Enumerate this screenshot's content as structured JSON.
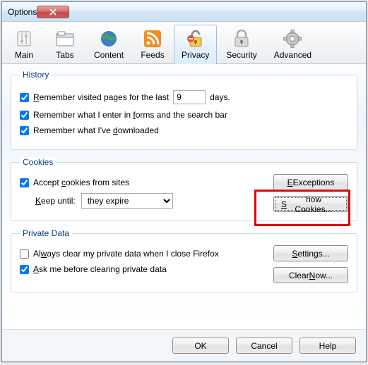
{
  "window": {
    "title": "Options"
  },
  "tabs": [
    {
      "label": "Main"
    },
    {
      "label": "Tabs"
    },
    {
      "label": "Content"
    },
    {
      "label": "Feeds"
    },
    {
      "label": "Privacy"
    },
    {
      "label": "Security"
    },
    {
      "label": "Advanced"
    }
  ],
  "history": {
    "legend": "History",
    "remember_visited": "emember visited pages for the last",
    "days_value": "9",
    "days_suffix": "days.",
    "remember_forms": "Remember what I enter in ",
    "forms_word": "f",
    "forms_rest": "orms and the search bar",
    "remember_downloads": "Remember what I've ",
    "downloads_d": "d",
    "downloads_rest": "ownloaded"
  },
  "cookies": {
    "legend": "Cookies",
    "accept": "Accept ",
    "accept_c": "c",
    "accept_rest": "ookies from sites",
    "keep_label": "eep until:",
    "keep_value": "they expire",
    "exceptions": "Exceptions",
    "show": "how Cookies..."
  },
  "private": {
    "legend": "Private Data",
    "always_clear": "Al",
    "always_w": "w",
    "always_rest": "ays clear my private data when I close Firefox",
    "ask_a": "A",
    "ask_rest": "sk me before clearing private data",
    "settings": "ettings...",
    "clear_now": "Clear ",
    "clear_n": "N",
    "clear_rest": "ow..."
  },
  "footer": {
    "ok": "OK",
    "cancel": "Cancel",
    "help": "Help"
  }
}
